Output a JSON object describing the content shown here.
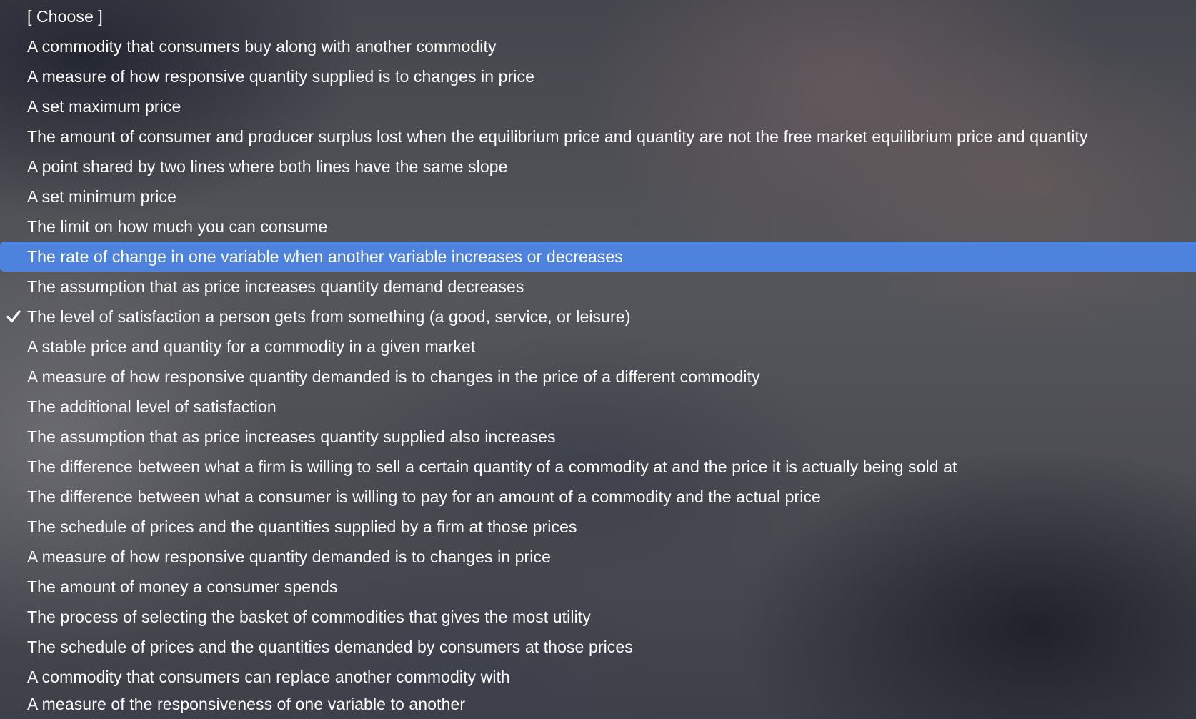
{
  "menu": {
    "placeholder": "[ Choose ]",
    "items": [
      "A commodity that consumers buy along with another commodity",
      "A measure of how responsive quantity supplied is to changes in price",
      "A set maximum price",
      "The amount of consumer and producer surplus lost when the equilibrium price and quantity are not the free market equilibrium price and quantity",
      "A point shared by two lines where both lines have the same slope",
      "A set minimum price",
      "The limit on how much you can consume",
      "The rate of change in one variable when another variable increases or decreases",
      "The assumption that as price increases quantity demand decreases",
      "The level of satisfaction a person gets from something (a good, service, or leisure)",
      "A stable price and quantity for a commodity in a given market",
      "A measure of how responsive quantity demanded is to changes in the price of a different commodity",
      "The additional level of satisfaction",
      "The assumption that as price increases quantity supplied also increases",
      "The difference between what a firm is willing to sell a certain quantity of a commodity at and the price it is actually being sold at",
      "The difference between what a consumer is willing to pay for an amount of a commodity and the actual price",
      "The schedule of prices and the quantities supplied by a firm at those prices",
      "A measure of how responsive quantity demanded is to changes in price",
      "The amount of money a consumer spends",
      "The process of selecting the basket of commodities that gives the most utility",
      "The schedule of prices and the quantities demanded by consumers at those prices",
      "A commodity that consumers can replace another commodity with",
      "A measure of the responsiveness of one variable to another"
    ],
    "highlighted_item": "The rate of change in one variable when another variable increases or decreases",
    "checked_item": "The level of satisfaction a person gets from something (a good, service, or leisure)",
    "check_icon": "checkmark-icon",
    "highlight_color": "#4d83dc"
  }
}
